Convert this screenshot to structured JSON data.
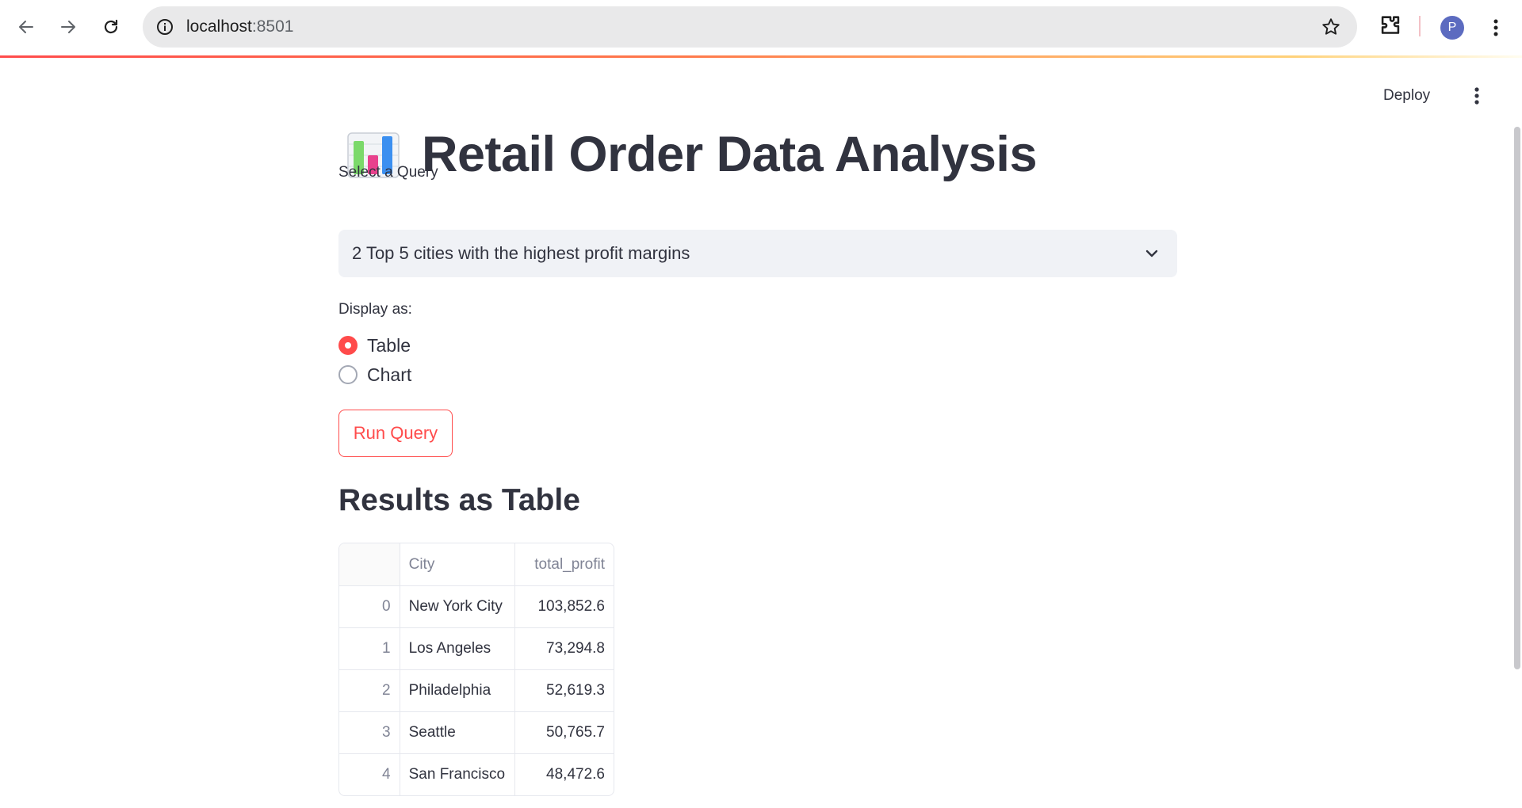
{
  "browser": {
    "url_host": "localhost",
    "url_port": ":8501",
    "avatar_letter": "P"
  },
  "app_header": {
    "deploy_label": "Deploy"
  },
  "page": {
    "title": "Retail Order Data Analysis",
    "title_icon": "bar-chart-emoji"
  },
  "query_select": {
    "label": "Select a Query",
    "value": "2 Top 5 cities with the highest profit margins"
  },
  "display_as": {
    "label": "Display as:",
    "options": [
      "Table",
      "Chart"
    ],
    "selected": "Table"
  },
  "run_button": {
    "label": "Run Query"
  },
  "results": {
    "title": "Results as Table",
    "columns": [
      "",
      "City",
      "total_profit"
    ],
    "rows": [
      {
        "index": "0",
        "city": "New York City",
        "total_profit": "103,852.6"
      },
      {
        "index": "1",
        "city": "Los Angeles",
        "total_profit": "73,294.8"
      },
      {
        "index": "2",
        "city": "Philadelphia",
        "total_profit": "52,619.3"
      },
      {
        "index": "3",
        "city": "Seattle",
        "total_profit": "50,765.7"
      },
      {
        "index": "4",
        "city": "San Francisco",
        "total_profit": "48,472.6"
      }
    ]
  },
  "colors": {
    "accent": "#ff4b4b",
    "text": "#31333f",
    "select_bg": "#f0f2f6"
  }
}
